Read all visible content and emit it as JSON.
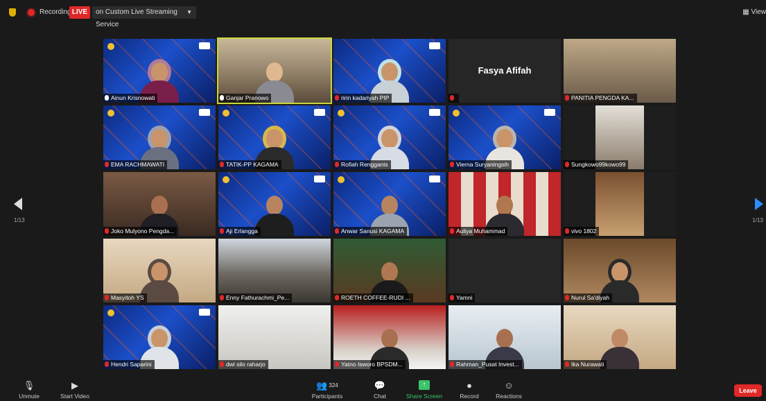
{
  "topbar": {
    "recording_label": "Recording",
    "live_label": "LIVE",
    "stream_label": "on Custom Live Streaming Service",
    "view_label": "View"
  },
  "navigation": {
    "page_left": "1/13",
    "page_right": "1/13"
  },
  "tiles": [
    {
      "name": "Ainun Krisnowati",
      "muted": false
    },
    {
      "name": "Ganjar Pranowo",
      "muted": false
    },
    {
      "name": "ririn kadariyah PIP",
      "muted": true
    },
    {
      "name": "",
      "muted": true,
      "display_name": "Fasya Afifah"
    },
    {
      "name": "PANITIA PENGDA KA...",
      "muted": true
    },
    {
      "name": "EMA RACHMAWATI",
      "muted": true
    },
    {
      "name": "TATIK-PP KAGAMA",
      "muted": true
    },
    {
      "name": "Rofiah Rengganis",
      "muted": true
    },
    {
      "name": "Vierna Suryaningsih",
      "muted": true
    },
    {
      "name": "Sungkowo99kowo99",
      "muted": true
    },
    {
      "name": "Joko Mulyono Pengda...",
      "muted": true
    },
    {
      "name": "Aji Erlangga",
      "muted": true
    },
    {
      "name": "Anwar Sanusi KAGAMA",
      "muted": true
    },
    {
      "name": "Auliya Muhammad",
      "muted": true
    },
    {
      "name": "vivo 1802",
      "muted": true
    },
    {
      "name": "Masyitoh YS",
      "muted": true
    },
    {
      "name": "Enny Fathurachmi_Pe...",
      "muted": true
    },
    {
      "name": "ROETH COFFEE-RUDI ...",
      "muted": true
    },
    {
      "name": "Yamni",
      "muted": true
    },
    {
      "name": "Nurul Sa'diyah",
      "muted": true
    },
    {
      "name": "Hendri Saparini",
      "muted": true
    },
    {
      "name": "dwi silo raharjo",
      "muted": true
    },
    {
      "name": "Yatno Isworo BPSDM...",
      "muted": true
    },
    {
      "name": "Rahman_Pusat Invest...",
      "muted": true
    },
    {
      "name": "Ika Nurawati",
      "muted": true
    }
  ],
  "toolbar": {
    "unmute": "Unmute",
    "start_video": "Start Video",
    "participants": "Participants",
    "participants_count": "324",
    "chat": "Chat",
    "share_screen": "Share Screen",
    "record": "Record",
    "reactions": "Reactions",
    "leave": "Leave"
  },
  "colors": {
    "live": "#e02828",
    "active_speaker": "#c8d93c",
    "share_green": "#3cc36a",
    "next_arrow": "#2d8cff"
  }
}
